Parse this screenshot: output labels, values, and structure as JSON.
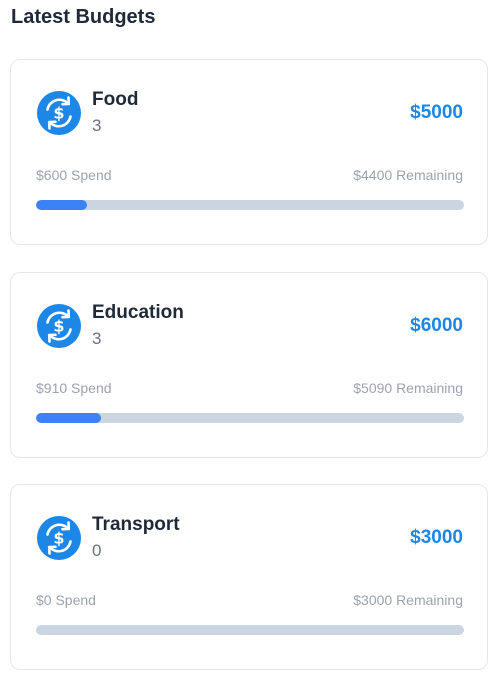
{
  "page": {
    "title": "Latest Budgets"
  },
  "accent_color": "#1d87e8",
  "progress_color": "#3b82f6",
  "track_color": "#cbd5e1",
  "budgets": [
    {
      "name": "Food",
      "count": "3",
      "amount": "$5000",
      "spend": "$600 Spend",
      "remaining": "$4400 Remaining",
      "progress": 0.12,
      "icon": "dollar-exchange-icon"
    },
    {
      "name": "Education",
      "count": "3",
      "amount": "$6000",
      "spend": "$910 Spend",
      "remaining": "$5090 Remaining",
      "progress": 0.152,
      "icon": "dollar-exchange-icon"
    },
    {
      "name": "Transport",
      "count": "0",
      "amount": "$3000",
      "spend": "$0 Spend",
      "remaining": "$3000 Remaining",
      "progress": 0,
      "icon": "dollar-exchange-icon"
    }
  ]
}
